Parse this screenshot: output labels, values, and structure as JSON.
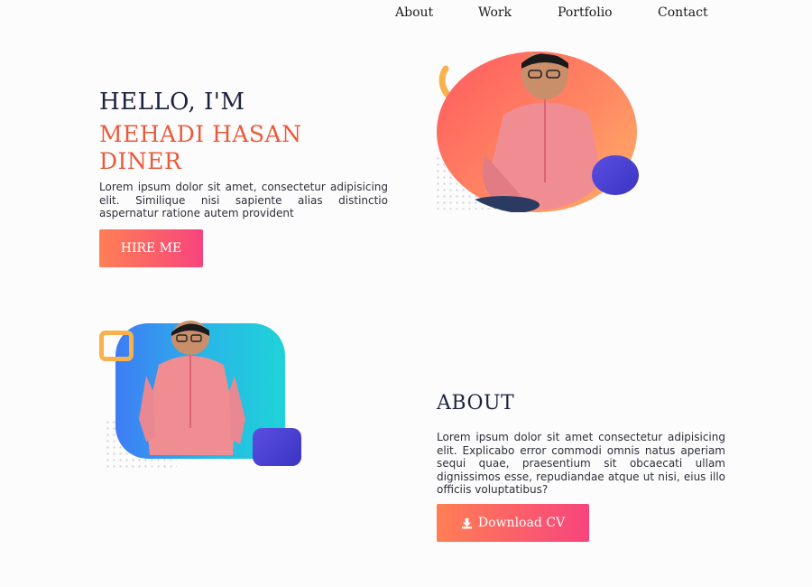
{
  "nav": {
    "items": [
      "About",
      "Work",
      "Portfolio",
      "Contact"
    ]
  },
  "hero": {
    "greeting": "HELLO, I'M",
    "name": "MEHADI HASAN DINER",
    "description": "Lorem ipsum dolor sit amet, consectetur adipisicing elit. Similique nisi sapiente alias distinctio aspernatur ratione autem provident",
    "button_label": "HIRE ME"
  },
  "about": {
    "title": "ABOUT",
    "description": "Lorem ipsum dolor sit amet consectetur adipisicing elit. Explicabo error commodi omnis natus aperiam sequi quae, praesentium sit obcaecati ullam dignissimos esse, repudiandae atque ut nisi, eius illo officiis voluptatibus?",
    "button_label": "Download CV",
    "button_icon": "download-icon"
  },
  "colors": {
    "accent_orange": "#ea5a3a",
    "button_gradient_start": "#ff7f54",
    "button_gradient_end": "#f7447d",
    "heading": "#1d2240",
    "hero_circle_start": "#ff5a5f",
    "hero_circle_end": "#ffa060",
    "about_card_start": "#3f7cf5",
    "about_card_end": "#1fd3d8",
    "shape_purple": "#4b3fd6",
    "shape_yellow": "#f7b24e"
  }
}
